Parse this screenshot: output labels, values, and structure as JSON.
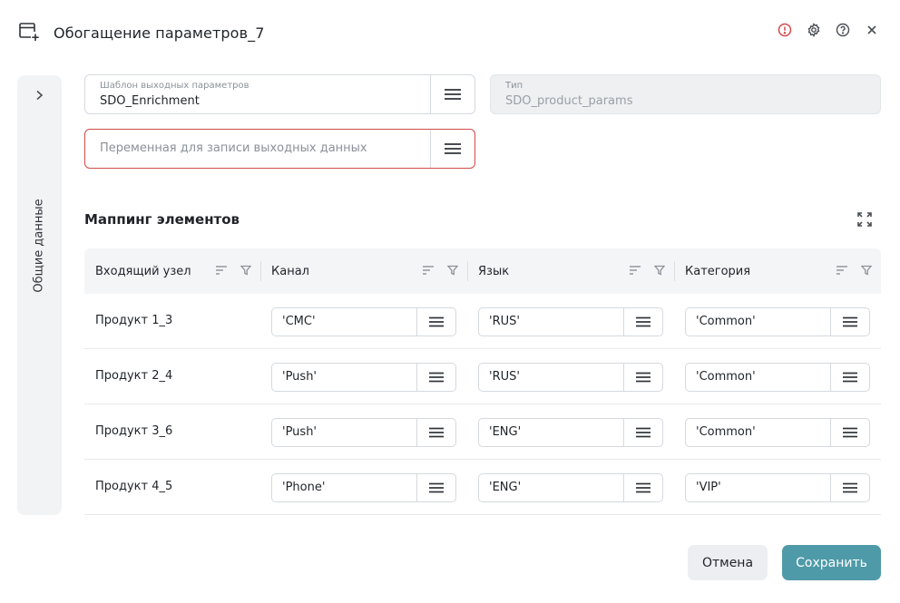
{
  "dialog": {
    "title": "Обогащение параметров_7",
    "icons": {
      "window": "window-plus-icon",
      "alert": "alert-icon",
      "settings": "gear-icon",
      "help": "help-icon",
      "close": "close-icon"
    },
    "colors": {
      "alert": "#d14a4a",
      "accent": "#4f9aa8",
      "error_border": "#d14a4a"
    }
  },
  "sidebar": {
    "label": "Общие данные"
  },
  "fields": {
    "template": {
      "label": "Шаблон выходных параметров",
      "value": "SDO_Enrichment"
    },
    "type": {
      "label": "Тип",
      "value": "SDO_product_params"
    },
    "output_var": {
      "placeholder": "Переменная для записи выходных данных"
    }
  },
  "mapping": {
    "title": "Маппинг элементов",
    "columns": [
      "Входящий узел",
      "Канал",
      "Язык",
      "Категория"
    ],
    "rows": [
      {
        "node": "Продукт 1_3",
        "channel": "'СМС'",
        "lang": "'RUS'",
        "category": "'Common'"
      },
      {
        "node": "Продукт 2_4",
        "channel": "'Push'",
        "lang": "'RUS'",
        "category": "'Common'"
      },
      {
        "node": "Продукт 3_6",
        "channel": "'Push'",
        "lang": "'ENG'",
        "category": "'Common'"
      },
      {
        "node": "Продукт 4_5",
        "channel": "'Phone'",
        "lang": "'ENG'",
        "category": "'VIP'"
      }
    ]
  },
  "footer": {
    "cancel": "Отмена",
    "save": "Сохранить"
  }
}
